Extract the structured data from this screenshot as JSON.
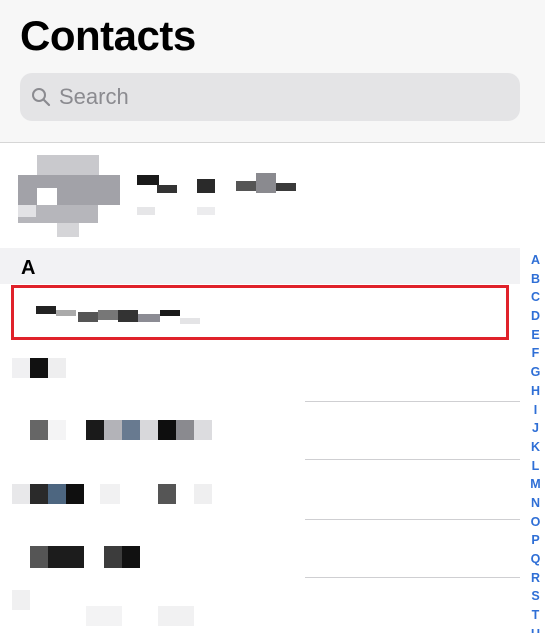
{
  "header": {
    "title": "Contacts",
    "search": {
      "placeholder": "Search",
      "icon": "search-icon"
    }
  },
  "sections": [
    {
      "letter": "A"
    }
  ],
  "alphabet_index": [
    "A",
    "B",
    "C",
    "D",
    "E",
    "F",
    "G",
    "H",
    "I",
    "J",
    "K",
    "L",
    "M",
    "N",
    "O",
    "P",
    "Q",
    "R",
    "S",
    "T",
    "U"
  ],
  "colors": {
    "accent": "#2f6fd6",
    "highlight": "#e0222a",
    "header_bg": "#f7f7f7",
    "search_bg": "#e4e4e6",
    "placeholder": "#8b8b90"
  }
}
